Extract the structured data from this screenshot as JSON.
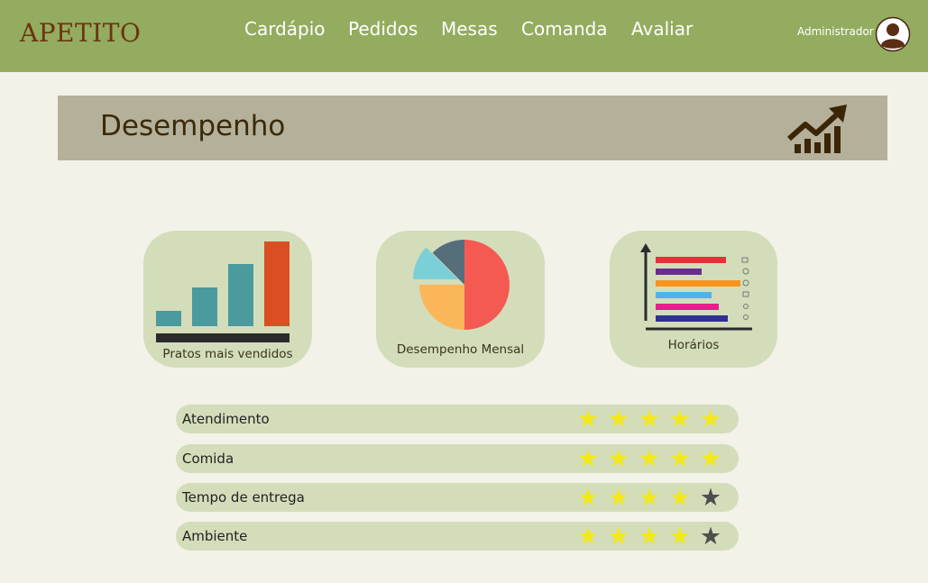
{
  "nav": {
    "brand": "APETITO",
    "links": [
      "Cardápio",
      "Pedidos",
      "Mesas",
      "Comanda",
      "Avaliar"
    ],
    "user": "Administrador"
  },
  "banner": {
    "title": "Desempenho"
  },
  "cards": [
    {
      "label": "Pratos mais vendidos",
      "icon": "bar-chart-icon"
    },
    {
      "label": "Desempenho Mensal",
      "icon": "pie-chart-icon"
    },
    {
      "label": "Horários",
      "icon": "horizontal-bar-chart-icon"
    }
  ],
  "ratings": [
    {
      "label": "Atendimento",
      "stars": 5,
      "max": 5
    },
    {
      "label": "Comida",
      "stars": 5,
      "max": 5
    },
    {
      "label": "Tempo de entrega",
      "stars": 4,
      "max": 5
    },
    {
      "label": "Ambiente",
      "stars": 4,
      "max": 5
    }
  ],
  "colors": {
    "navbar": "#93ac5f",
    "brand": "#6b3410",
    "banner": "#b5b09a",
    "card": "#d3ddba",
    "star_on": "#f3e81a",
    "star_off": "#4e4e4e"
  }
}
